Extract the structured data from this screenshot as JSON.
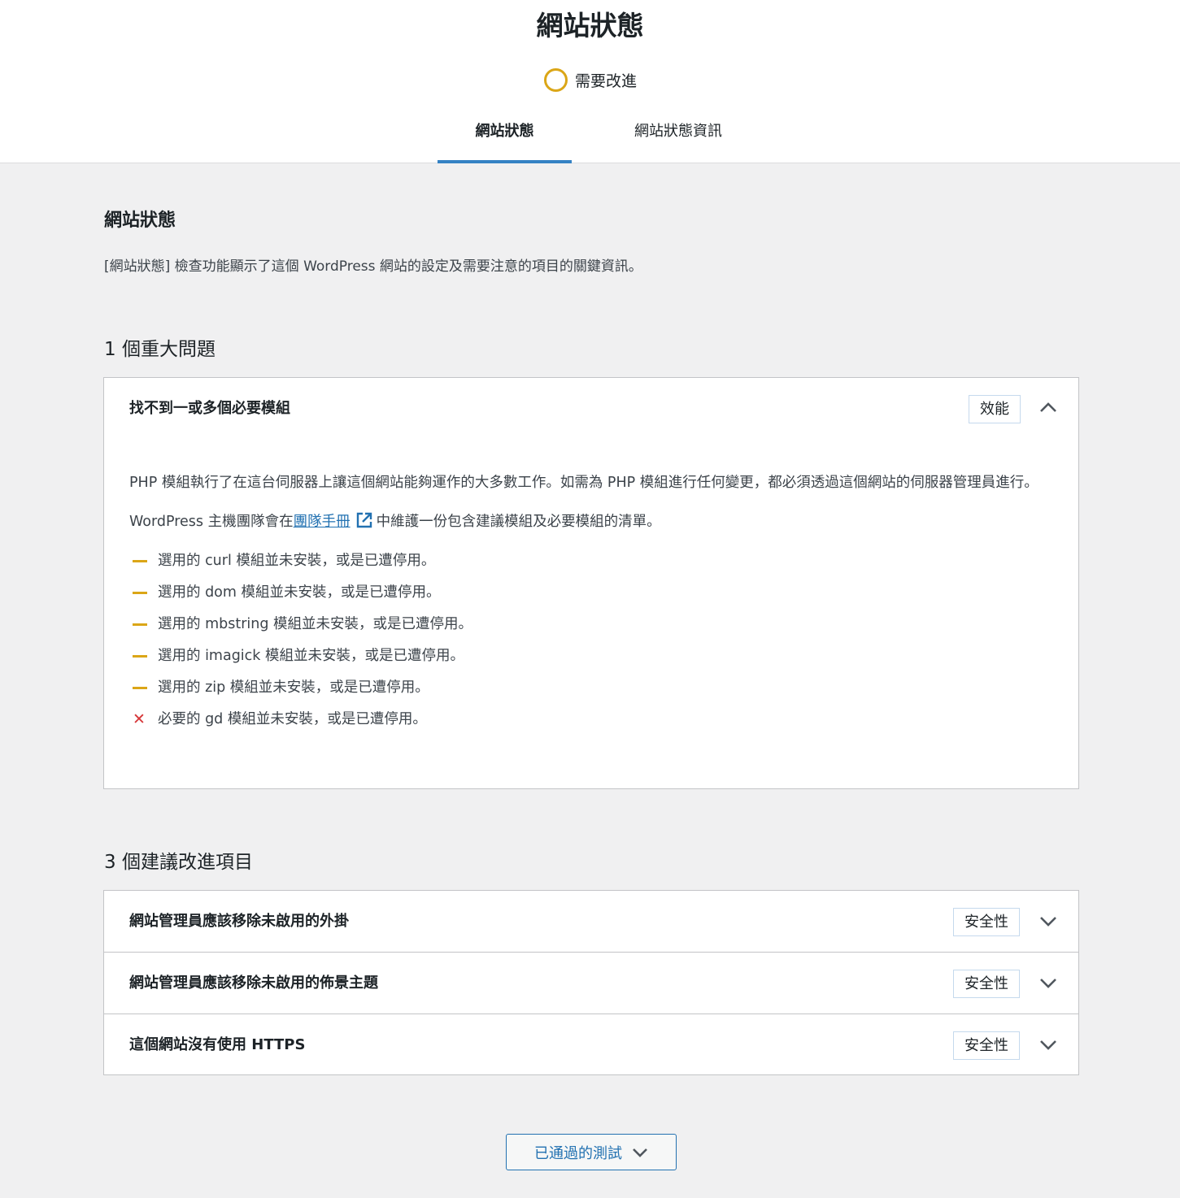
{
  "header": {
    "title": "網站狀態",
    "score_label": "需要改進",
    "tabs": [
      {
        "label": "網站狀態",
        "active": true
      },
      {
        "label": "網站狀態資訊",
        "active": false
      }
    ]
  },
  "main": {
    "heading": "網站狀態",
    "intro": "[網站狀態] 檢查功能顯示了這個 WordPress 網站的設定及需要注意的項目的關鍵資訊。",
    "critical": {
      "title": "1 個重大問題",
      "item": {
        "title": "找不到一或多個必要模組",
        "badge": "效能",
        "paragraph1": "PHP 模組執行了在這台伺服器上讓這個網站能夠運作的大多數工作。如需為 PHP 模組進行任何變更，都必須透過這個網站的伺服器管理員進行。",
        "paragraph2_before": "WordPress 主機團隊會在",
        "paragraph2_link": "團隊手冊",
        "paragraph2_after": "中維護一份包含建議模組及必要模組的清單。",
        "modules": [
          {
            "status": "warning",
            "text": "選用的 curl 模組並未安裝，或是已遭停用。"
          },
          {
            "status": "warning",
            "text": "選用的 dom 模組並未安裝，或是已遭停用。"
          },
          {
            "status": "warning",
            "text": "選用的 mbstring 模組並未安裝，或是已遭停用。"
          },
          {
            "status": "warning",
            "text": "選用的 imagick 模組並未安裝，或是已遭停用。"
          },
          {
            "status": "warning",
            "text": "選用的 zip 模組並未安裝，或是已遭停用。"
          },
          {
            "status": "error",
            "text": "必要的 gd 模組並未安裝，或是已遭停用。"
          }
        ]
      }
    },
    "recommended": {
      "title": "3 個建議改進項目",
      "items": [
        {
          "title": "網站管理員應該移除未啟用的外掛",
          "badge": "安全性"
        },
        {
          "title": "網站管理員應該移除未啟用的佈景主題",
          "badge": "安全性"
        },
        {
          "title": "這個網站沒有使用 HTTPS",
          "badge": "安全性"
        }
      ]
    },
    "passed_button": "已通過的測試"
  },
  "colors": {
    "accent": "#3582c4",
    "link": "#2271b1",
    "warning": "#dba617",
    "error": "#d63638"
  }
}
